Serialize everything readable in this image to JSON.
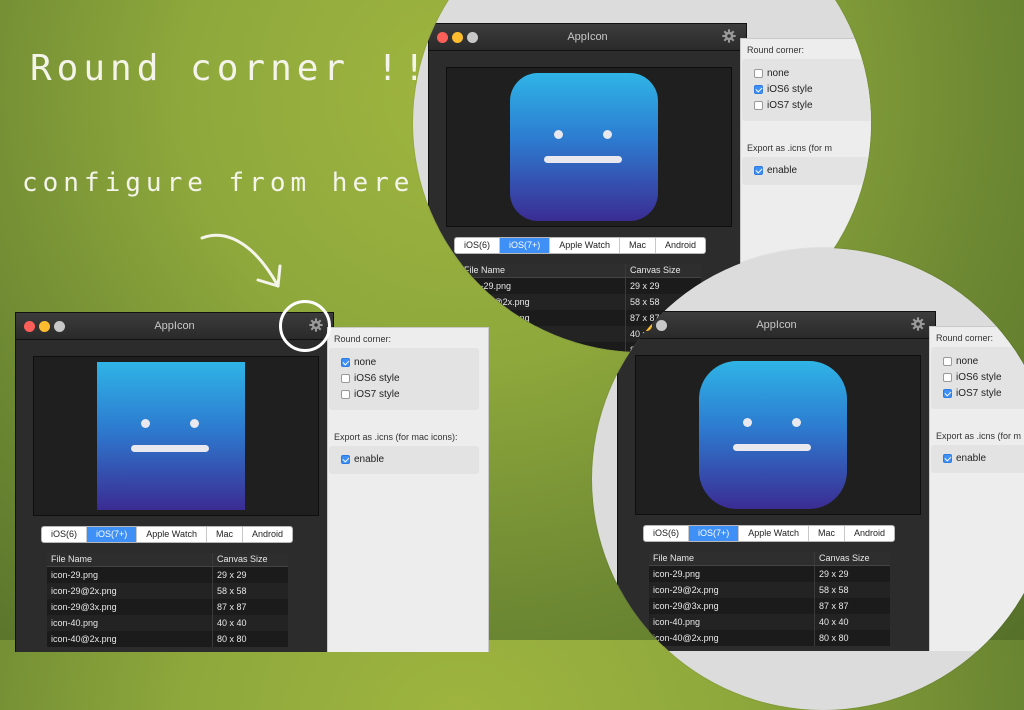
{
  "annotations": {
    "headline": "Round corner !!",
    "subline": "configure from here"
  },
  "window": {
    "title": "AppIcon",
    "tabs": [
      "iOS(6)",
      "iOS(7+)",
      "Apple Watch",
      "Mac",
      "Android"
    ],
    "active_tab": "iOS(7+)",
    "table": {
      "headers": [
        "File Name",
        "Canvas Size"
      ],
      "rows": [
        [
          "icon-29.png",
          "29 x 29"
        ],
        [
          "icon-29@2x.png",
          "58 x 58"
        ],
        [
          "icon-29@3x.png",
          "87 x 87"
        ],
        [
          "icon-40.png",
          "40 x 40"
        ],
        [
          "icon-40@2x.png",
          "80 x 80"
        ]
      ]
    },
    "round_corner_label": "Round corner:",
    "round_options": [
      "none",
      "iOS6 style",
      "iOS7 style"
    ],
    "export_label": "Export as .icns (for mac icons):",
    "export_label_truncated": "Export as .icns (for m",
    "enable_label": "enable"
  },
  "instances": {
    "left": {
      "selected_round": "none",
      "corner": "square"
    },
    "top_right": {
      "selected_round": "iOS6 style",
      "corner": "ios6"
    },
    "bottom_right": {
      "selected_round": "iOS7 style",
      "corner": "ios7"
    }
  },
  "colors": {
    "accent": "#3e8ff6",
    "icon_top": "#2fb4e6",
    "icon_bottom": "#3b2c93",
    "background": "#8ea83c"
  },
  "icons": [
    "gear-icon",
    "arrow-icon",
    "checkbox-icon"
  ]
}
